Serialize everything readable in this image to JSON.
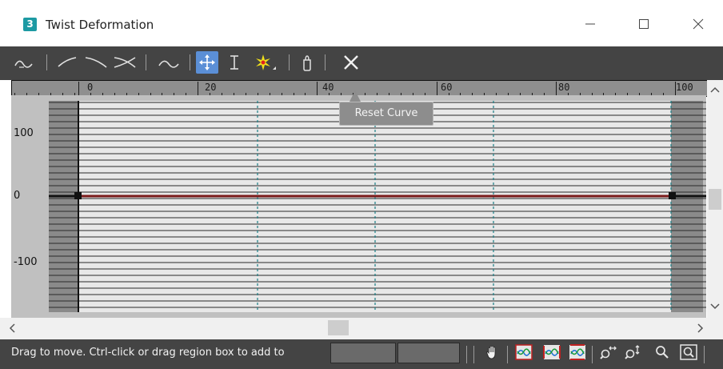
{
  "window": {
    "title": "Twist Deformation",
    "icon_text": "3",
    "icon_color": "#1d9aa3"
  },
  "caption_buttons": [
    "minimize",
    "maximize",
    "close"
  ],
  "toolbar": {
    "buttons": [
      {
        "id": "make-symmetrical",
        "icon": "symmetry-icon"
      },
      {
        "id": "curve-1",
        "icon": "curve-ascending-icon"
      },
      {
        "id": "curve-2",
        "icon": "curve-descending-icon"
      },
      {
        "id": "curve-both",
        "icon": "curve-cross-icon"
      },
      {
        "id": "swap-curves",
        "icon": "swap-curve-icon"
      },
      {
        "id": "move-control-point",
        "icon": "move-point-icon",
        "active": true
      },
      {
        "id": "scale-control-point",
        "icon": "scale-point-icon"
      },
      {
        "id": "insert-corner-point",
        "icon": "insert-point-icon"
      },
      {
        "id": "delete-control-point",
        "icon": "delete-point-icon"
      },
      {
        "id": "reset-curve",
        "icon": "reset-curve-icon"
      }
    ]
  },
  "ruler": {
    "labels": [
      "0",
      "20",
      "40",
      "60",
      "80",
      "100"
    ]
  },
  "y_axis": {
    "labels": [
      "100",
      "0",
      "-100"
    ]
  },
  "tooltip": {
    "text": "Reset Curve"
  },
  "colors": {
    "toolbar_bg": "#444444",
    "active_button": "#5b8fd6",
    "curve": "#7a1a1a",
    "gridline_dashed": "#1a7f86",
    "plot_bg": "#e8e8e8"
  },
  "status": {
    "text": "Drag to move. Ctrl-click or drag region box to add to",
    "field1": "",
    "field2": ""
  },
  "status_buttons": [
    {
      "id": "pan",
      "icon": "pan-hand-icon"
    },
    {
      "id": "zoom-extents",
      "icon": "zoom-extents-icon"
    },
    {
      "id": "zoom-horizontal-extents",
      "icon": "zoom-horizontal-extents-icon"
    },
    {
      "id": "zoom-vertical-extents",
      "icon": "zoom-vertical-extents-icon"
    },
    {
      "id": "zoom-horizontal",
      "icon": "zoom-horizontal-icon"
    },
    {
      "id": "zoom-vertical",
      "icon": "zoom-vertical-icon"
    },
    {
      "id": "zoom",
      "icon": "zoom-icon"
    },
    {
      "id": "zoom-region",
      "icon": "zoom-region-icon"
    }
  ]
}
